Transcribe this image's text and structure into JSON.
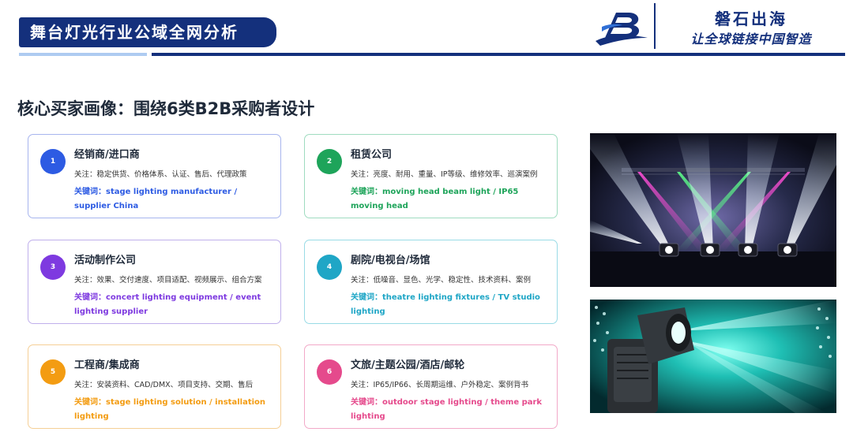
{
  "header": {
    "title": "舞台灯光行业公域全网分析",
    "brand_name": "磐石出海",
    "brand_slogan": "让全球链接中国智造"
  },
  "section": {
    "title": "核心买家画像：围绕6类B2B采购者设计"
  },
  "cards": [
    {
      "number": "1",
      "title": "经销商/进口商",
      "focus": "关注：稳定供货、价格体系、认证、售后、代理政策",
      "keyword": "关键词：stage lighting manufacturer / supplier China",
      "color": "#2d5be3"
    },
    {
      "number": "2",
      "title": "租赁公司",
      "focus": "关注：亮度、耐用、重量、IP等级、维修效率、巡演案例",
      "keyword": "关键词：moving head beam light / IP65 moving head",
      "color": "#1ea45a"
    },
    {
      "number": "3",
      "title": "活动制作公司",
      "focus": "关注：效果、交付速度、项目适配、视频展示、组合方案",
      "keyword": "关键词：concert lighting equipment / event lighting supplier",
      "color": "#7e3ae0"
    },
    {
      "number": "4",
      "title": "剧院/电视台/场馆",
      "focus": "关注：低噪音、显色、光学、稳定性、技术资料、案例",
      "keyword": "关键词：theatre lighting fixtures / TV studio lighting",
      "color": "#1fa6c6"
    },
    {
      "number": "5",
      "title": "工程商/集成商",
      "focus": "关注：安装资料、CAD/DMX、项目支持、交期、售后",
      "keyword": "关键词：stage lighting solution / installation lighting",
      "color": "#f39c12"
    },
    {
      "number": "6",
      "title": "文旅/主题公园/酒店/邮轮",
      "focus": "关注：IP65/IP66、长周期运维、户外稳定、案例背书",
      "keyword": "关键词：outdoor stage lighting / theme park lighting",
      "color": "#e54a8c"
    }
  ],
  "images": [
    {
      "icon": "concert-stage-lighting-photo"
    },
    {
      "icon": "moving-head-fixture-photo"
    }
  ]
}
